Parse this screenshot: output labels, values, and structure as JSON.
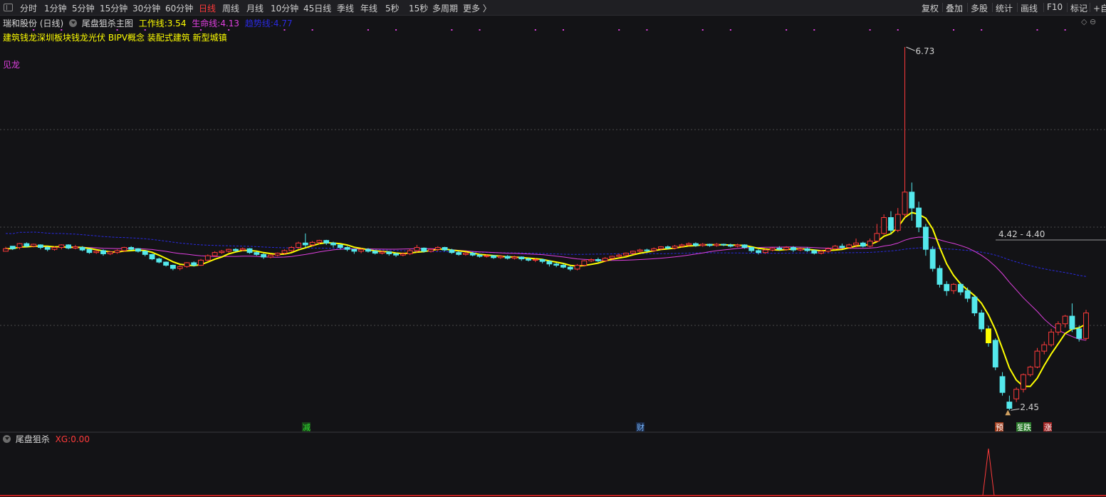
{
  "toolbar": {
    "timeframes": [
      "分时",
      "1分钟",
      "5分钟",
      "15分钟",
      "30分钟",
      "60分钟",
      "日线",
      "周线",
      "月线",
      "10分钟",
      "45日线",
      "季线",
      "年线",
      "5秒",
      "15秒",
      "多周期",
      "更多 〉"
    ],
    "active": "日线",
    "right_buttons": [
      "复权",
      "叠加",
      "多股",
      "统计",
      "画线",
      "F10",
      "标记",
      "+自"
    ]
  },
  "main_panel": {
    "stock_label": "瑞和股份 (日线)",
    "indicator_name": "尾盘狙杀主图",
    "work_line": {
      "label": "工作线:",
      "value": "3.54",
      "color": "#ffff00"
    },
    "life_line": {
      "label": "生命线:",
      "value": "4.13",
      "color": "#e040e0"
    },
    "trend_line": {
      "label": "趋势线:",
      "value": "4.77",
      "color": "#2a2ae0"
    },
    "concepts": "建筑钱龙深圳板块钱龙光伏 BIPV概念 装配式建筑 新型城镇",
    "side_label": "见龙",
    "high_label": "6.73",
    "low_label": "2.45",
    "range_label": "4.42 - 4.40",
    "markers": [
      {
        "text": "减",
        "color": "#30e030",
        "bg": "#184418"
      },
      {
        "text": "财",
        "color": "#7ab8ff",
        "bg": "#1a2a48"
      },
      {
        "text": "预",
        "color": "#ffffff",
        "bg": "#a03a1a"
      },
      {
        "text": "狙",
        "color": "#ffffff",
        "bg": "#2a7a2a"
      },
      {
        "text": "跌",
        "color": "#ffffff",
        "bg": "#2a7a2a"
      },
      {
        "text": "涨",
        "color": "#ffffff",
        "bg": "#a02020"
      }
    ]
  },
  "sub_panel": {
    "indicator_name": "尾盘狙杀",
    "xg_label": "XG:",
    "xg_value": "0.00"
  },
  "colors": {
    "up": "#ff3b3b",
    "down": "#54e8ec",
    "bg": "#131316",
    "magenta": "#e040e0",
    "yellow": "#ffff00",
    "navy": "#2a2ae0",
    "grid": "#4a4a4a"
  },
  "chart_data": {
    "type": "candlestick",
    "xg_peak_value": 1,
    "candles": [
      [
        3.52,
        3.56,
        3.55,
        3.59
      ],
      [
        3.6,
        3.56,
        3.54,
        3.6
      ],
      [
        3.58,
        3.64,
        3.55,
        3.65
      ],
      [
        3.64,
        3.6,
        3.58,
        3.66
      ],
      [
        3.6,
        3.63,
        3.58,
        3.64
      ],
      [
        3.62,
        3.58,
        3.55,
        3.63
      ],
      [
        3.58,
        3.55,
        3.52,
        3.6
      ],
      [
        3.55,
        3.58,
        3.53,
        3.6
      ],
      [
        3.58,
        3.62,
        3.55,
        3.63
      ],
      [
        3.62,
        3.57,
        3.55,
        3.63
      ],
      [
        3.57,
        3.59,
        3.55,
        3.62
      ],
      [
        3.58,
        3.54,
        3.52,
        3.6
      ],
      [
        3.55,
        3.5,
        3.48,
        3.56
      ],
      [
        3.5,
        3.52,
        3.48,
        3.54
      ],
      [
        3.53,
        3.48,
        3.45,
        3.55
      ],
      [
        3.48,
        3.51,
        3.46,
        3.52
      ],
      [
        3.5,
        3.53,
        3.48,
        3.55
      ],
      [
        3.53,
        3.58,
        3.51,
        3.59
      ],
      [
        3.58,
        3.55,
        3.53,
        3.6
      ],
      [
        3.56,
        3.52,
        3.5,
        3.57
      ],
      [
        3.52,
        3.47,
        3.44,
        3.53
      ],
      [
        3.47,
        3.4,
        3.38,
        3.48
      ],
      [
        3.4,
        3.35,
        3.33,
        3.42
      ],
      [
        3.35,
        3.3,
        3.28,
        3.36
      ],
      [
        3.3,
        3.25,
        3.22,
        3.31
      ],
      [
        3.25,
        3.28,
        3.22,
        3.3
      ],
      [
        3.28,
        3.34,
        3.26,
        3.35
      ],
      [
        3.34,
        3.3,
        3.28,
        3.36
      ],
      [
        3.3,
        3.38,
        3.29,
        3.4
      ],
      [
        3.38,
        3.45,
        3.37,
        3.47
      ],
      [
        3.45,
        3.5,
        3.43,
        3.52
      ],
      [
        3.5,
        3.52,
        3.48,
        3.54
      ],
      [
        3.52,
        3.55,
        3.5,
        3.56
      ],
      [
        3.55,
        3.53,
        3.51,
        3.57
      ],
      [
        3.54,
        3.56,
        3.52,
        3.58
      ],
      [
        3.56,
        3.5,
        3.48,
        3.57
      ],
      [
        3.5,
        3.47,
        3.45,
        3.52
      ],
      [
        3.47,
        3.43,
        3.4,
        3.49
      ],
      [
        3.43,
        3.46,
        3.41,
        3.48
      ],
      [
        3.46,
        3.49,
        3.44,
        3.5
      ],
      [
        3.49,
        3.53,
        3.47,
        3.55
      ],
      [
        3.53,
        3.58,
        3.51,
        3.6
      ],
      [
        3.58,
        3.65,
        3.56,
        3.67
      ],
      [
        3.65,
        3.62,
        3.58,
        3.8
      ],
      [
        3.62,
        3.66,
        3.6,
        3.68
      ],
      [
        3.66,
        3.69,
        3.63,
        3.7
      ],
      [
        3.69,
        3.65,
        3.62,
        3.7
      ],
      [
        3.65,
        3.62,
        3.58,
        3.67
      ],
      [
        3.62,
        3.58,
        3.55,
        3.63
      ],
      [
        3.58,
        3.55,
        3.52,
        3.6
      ],
      [
        3.55,
        3.52,
        3.48,
        3.56
      ],
      [
        3.52,
        3.55,
        3.49,
        3.57
      ],
      [
        3.55,
        3.52,
        3.5,
        3.57
      ],
      [
        3.52,
        3.49,
        3.47,
        3.54
      ],
      [
        3.49,
        3.51,
        3.47,
        3.53
      ],
      [
        3.51,
        3.48,
        3.45,
        3.52
      ],
      [
        3.48,
        3.46,
        3.43,
        3.5
      ],
      [
        3.46,
        3.48,
        3.44,
        3.5
      ],
      [
        3.48,
        3.53,
        3.46,
        3.56
      ],
      [
        3.53,
        3.58,
        3.5,
        3.62
      ],
      [
        3.57,
        3.52,
        3.5,
        3.58
      ],
      [
        3.52,
        3.55,
        3.5,
        3.56
      ],
      [
        3.55,
        3.58,
        3.52,
        3.6
      ],
      [
        3.58,
        3.54,
        3.52,
        3.59
      ],
      [
        3.54,
        3.5,
        3.48,
        3.56
      ],
      [
        3.5,
        3.47,
        3.45,
        3.52
      ],
      [
        3.47,
        3.49,
        3.45,
        3.51
      ],
      [
        3.49,
        3.46,
        3.44,
        3.51
      ],
      [
        3.46,
        3.44,
        3.42,
        3.48
      ],
      [
        3.44,
        3.45,
        3.42,
        3.47
      ],
      [
        3.45,
        3.42,
        3.4,
        3.46
      ],
      [
        3.42,
        3.44,
        3.4,
        3.46
      ],
      [
        3.44,
        3.41,
        3.39,
        3.46
      ],
      [
        3.41,
        3.43,
        3.39,
        3.45
      ],
      [
        3.43,
        3.4,
        3.37,
        3.44
      ],
      [
        3.4,
        3.38,
        3.36,
        3.42
      ],
      [
        3.38,
        3.39,
        3.35,
        3.41
      ],
      [
        3.39,
        3.36,
        3.33,
        3.4
      ],
      [
        3.36,
        3.32,
        3.28,
        3.38
      ],
      [
        3.32,
        3.3,
        3.27,
        3.34
      ],
      [
        3.3,
        3.27,
        3.25,
        3.33
      ],
      [
        3.27,
        3.24,
        3.21,
        3.29
      ],
      [
        3.24,
        3.3,
        3.22,
        3.32
      ],
      [
        3.3,
        3.37,
        3.28,
        3.38
      ],
      [
        3.37,
        3.39,
        3.35,
        3.41
      ],
      [
        3.39,
        3.37,
        3.35,
        3.42
      ],
      [
        3.37,
        3.41,
        3.35,
        3.43
      ],
      [
        3.41,
        3.44,
        3.39,
        3.45
      ],
      [
        3.44,
        3.46,
        3.42,
        3.48
      ],
      [
        3.46,
        3.49,
        3.44,
        3.5
      ],
      [
        3.49,
        3.52,
        3.47,
        3.53
      ],
      [
        3.52,
        3.54,
        3.5,
        3.56
      ],
      [
        3.54,
        3.53,
        3.51,
        3.56
      ],
      [
        3.53,
        3.56,
        3.51,
        3.58
      ],
      [
        3.56,
        3.59,
        3.54,
        3.6
      ],
      [
        3.59,
        3.57,
        3.55,
        3.61
      ],
      [
        3.57,
        3.6,
        3.55,
        3.62
      ],
      [
        3.6,
        3.62,
        3.58,
        3.64
      ],
      [
        3.62,
        3.64,
        3.6,
        3.66
      ],
      [
        3.64,
        3.61,
        3.59,
        3.66
      ],
      [
        3.61,
        3.63,
        3.59,
        3.65
      ],
      [
        3.63,
        3.61,
        3.59,
        3.64
      ],
      [
        3.61,
        3.63,
        3.59,
        3.65
      ],
      [
        3.63,
        3.62,
        3.6,
        3.64
      ],
      [
        3.62,
        3.6,
        3.58,
        3.64
      ],
      [
        3.6,
        3.62,
        3.58,
        3.64
      ],
      [
        3.62,
        3.58,
        3.56,
        3.63
      ],
      [
        3.58,
        3.53,
        3.5,
        3.59
      ],
      [
        3.53,
        3.5,
        3.47,
        3.55
      ],
      [
        3.5,
        3.54,
        3.48,
        3.56
      ],
      [
        3.54,
        3.57,
        3.52,
        3.58
      ],
      [
        3.57,
        3.55,
        3.53,
        3.6
      ],
      [
        3.55,
        3.58,
        3.53,
        3.6
      ],
      [
        3.58,
        3.54,
        3.51,
        3.6
      ],
      [
        3.54,
        3.56,
        3.52,
        3.58
      ],
      [
        3.56,
        3.53,
        3.51,
        3.58
      ],
      [
        3.53,
        3.49,
        3.47,
        3.55
      ],
      [
        3.49,
        3.52,
        3.47,
        3.54
      ],
      [
        3.52,
        3.56,
        3.5,
        3.58
      ],
      [
        3.56,
        3.6,
        3.54,
        3.62
      ],
      [
        3.6,
        3.58,
        3.56,
        3.64
      ],
      [
        3.58,
        3.62,
        3.56,
        3.64
      ],
      [
        3.62,
        3.65,
        3.58,
        3.72
      ],
      [
        3.65,
        3.6,
        3.58,
        3.67
      ],
      [
        3.6,
        3.68,
        3.58,
        3.72
      ],
      [
        3.68,
        3.8,
        3.66,
        3.95
      ],
      [
        3.8,
        4.05,
        3.78,
        4.1
      ],
      [
        4.05,
        3.85,
        3.8,
        4.15
      ],
      [
        3.85,
        4.1,
        3.82,
        4.2
      ],
      [
        4.1,
        4.45,
        4.05,
        6.73
      ],
      [
        4.45,
        4.2,
        4.0,
        4.6
      ],
      [
        4.2,
        3.9,
        3.82,
        4.3
      ],
      [
        3.9,
        3.55,
        3.45,
        3.95
      ],
      [
        3.55,
        3.25,
        3.2,
        3.6
      ],
      [
        3.25,
        3.0,
        2.95,
        3.3
      ],
      [
        3.0,
        2.9,
        2.82,
        3.05
      ],
      [
        2.9,
        3.0,
        2.85,
        3.02
      ],
      [
        3.0,
        2.88,
        2.83,
        3.02
      ],
      [
        2.9,
        2.78,
        2.72,
        2.95
      ],
      [
        2.8,
        2.55,
        2.5,
        2.82
      ],
      [
        2.55,
        2.3,
        2.25,
        2.6
      ],
      [
        2.3,
        2.08,
        2.02,
        2.35
      ],
      [
        2.12,
        1.7,
        1.65,
        2.15
      ],
      [
        1.55,
        1.3,
        1.25,
        1.62
      ],
      [
        1.15,
        1.05,
        1.02,
        1.25
      ],
      [
        1.2,
        1.35,
        1.15,
        1.38
      ],
      [
        1.35,
        1.58,
        1.3,
        1.6
      ],
      [
        1.58,
        1.7,
        1.55,
        1.72
      ],
      [
        1.7,
        1.95,
        1.68,
        2.0
      ],
      [
        1.95,
        2.05,
        1.9,
        2.1
      ],
      [
        2.05,
        2.25,
        2.02,
        2.3
      ],
      [
        2.25,
        2.38,
        2.2,
        2.42
      ],
      [
        2.38,
        2.5,
        2.32,
        2.52
      ],
      [
        2.5,
        2.3,
        2.25,
        2.7
      ],
      [
        2.3,
        2.15,
        2.1,
        2.35
      ],
      [
        2.15,
        2.55,
        2.12,
        2.6
      ]
    ]
  }
}
